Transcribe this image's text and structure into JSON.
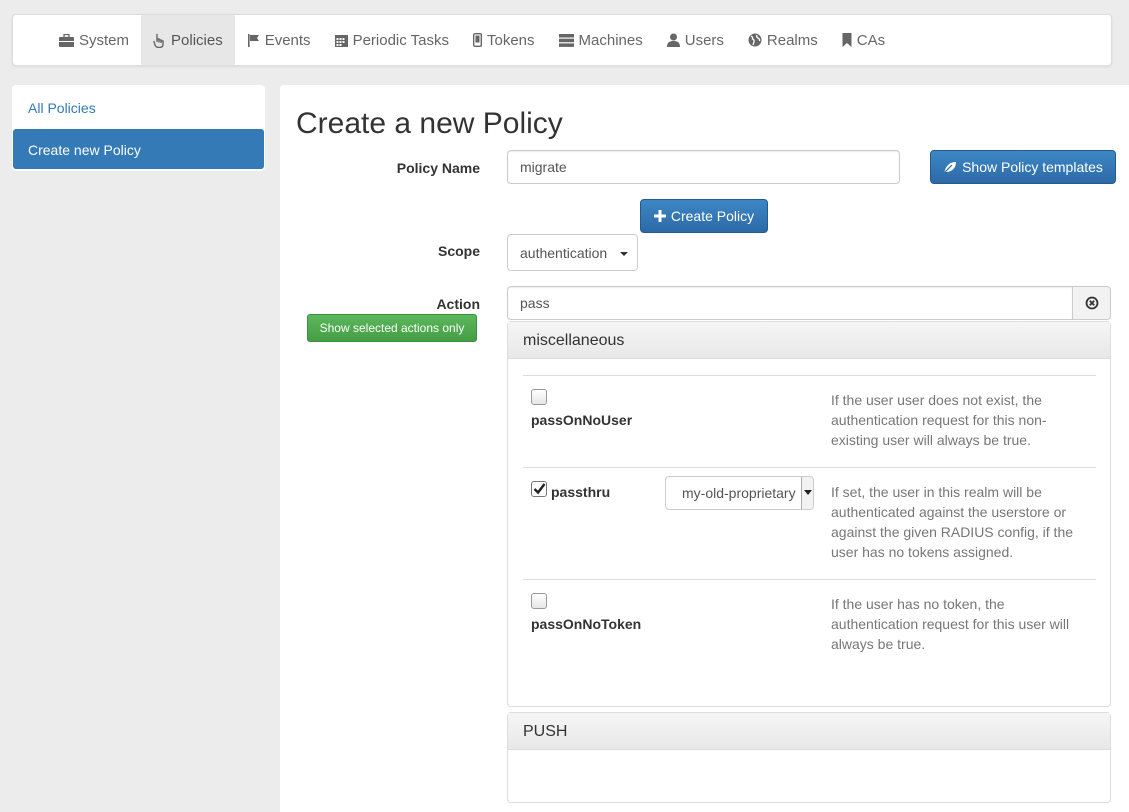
{
  "nav": {
    "items": [
      {
        "label": "System",
        "icon": "briefcase-icon"
      },
      {
        "label": "Policies",
        "icon": "hand-pointer-icon",
        "active": true
      },
      {
        "label": "Events",
        "icon": "flag-icon"
      },
      {
        "label": "Periodic Tasks",
        "icon": "calendar-icon"
      },
      {
        "label": "Tokens",
        "icon": "phone-icon"
      },
      {
        "label": "Machines",
        "icon": "server-icon"
      },
      {
        "label": "Users",
        "icon": "user-icon"
      },
      {
        "label": "Realms",
        "icon": "globe-icon"
      },
      {
        "label": "CAs",
        "icon": "bookmark-icon"
      }
    ]
  },
  "sidebar": {
    "all_policies": "All Policies",
    "create_new": "Create new Policy"
  },
  "form": {
    "title": "Create a new Policy",
    "policy_name_label": "Policy Name",
    "policy_name_value": "migrate",
    "templates_button": "Show Policy templates",
    "create_button": "Create Policy",
    "scope_label": "Scope",
    "scope_value": "authentication",
    "action_label": "Action",
    "action_filter_value": "pass",
    "show_selected_button": "Show selected actions only"
  },
  "groups": {
    "misc": {
      "title": "miscellaneous",
      "actions": [
        {
          "name": "passOnNoUser",
          "checked": false,
          "description": "If the user user does not exist, the authentication request for this non-existing user will always be true."
        },
        {
          "name": "passthru",
          "checked": true,
          "select_value": "my-old-proprietary",
          "description": "If set, the user in this realm will be authenticated against the userstore or against the given RADIUS config, if the user has no tokens assigned."
        },
        {
          "name": "passOnNoToken",
          "checked": false,
          "description": "If the user has no token, the authentication request for this user will always be true."
        }
      ]
    },
    "push": {
      "title": "PUSH"
    }
  },
  "colors": {
    "primary": "#337ab7",
    "success": "#5cb85c",
    "background": "#ececec"
  }
}
